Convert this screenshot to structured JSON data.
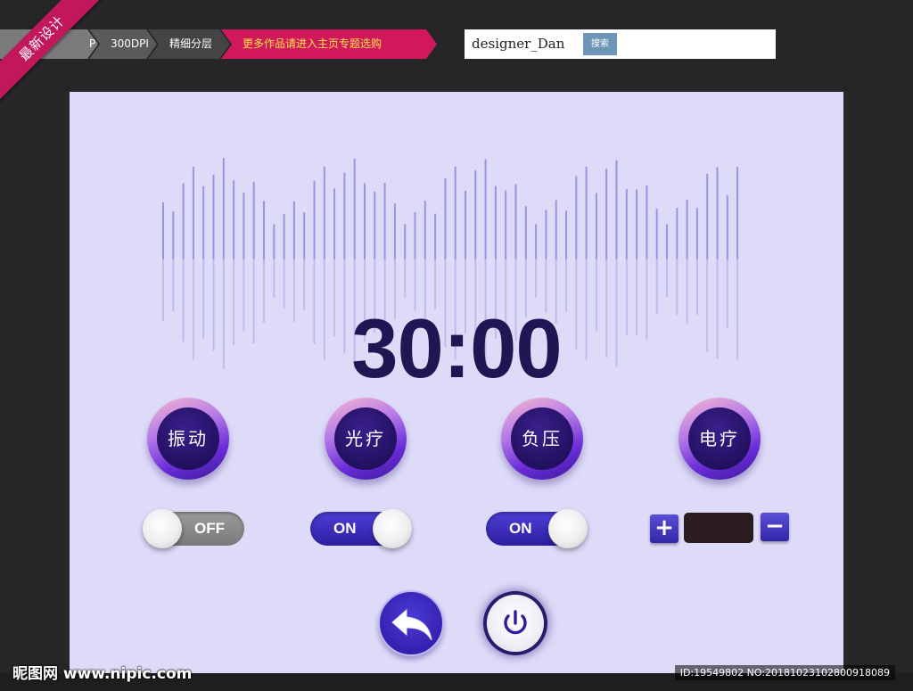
{
  "header": {
    "corner_ribbon": "最新设计",
    "crumbs": [
      "PSD",
      "300DPI",
      "精细分层",
      "更多作品请进入主页专题选购"
    ],
    "search": {
      "value": "designer_Dan",
      "button_label": "搜索"
    }
  },
  "timer": {
    "value": "30:00"
  },
  "modes": [
    {
      "label": "振动",
      "toggle": "OFF"
    },
    {
      "label": "光疗",
      "toggle": "ON"
    },
    {
      "label": "负压",
      "toggle": "ON"
    },
    {
      "label": "电疗",
      "stepper": {
        "plus": "+",
        "minus": "−",
        "value": ""
      }
    }
  ],
  "controls": {
    "back_icon": "undo-arrow-icon",
    "power_icon": "power-icon"
  },
  "watermark": {
    "left": "昵图网 www.nipic.com",
    "right": "ID:19549802 NO:20181023102800918089"
  },
  "colors": {
    "panel_bg": "#dedbf9",
    "timer_text": "#1f1654",
    "accent": "#3a2bc0",
    "ribbon": "#c2185b",
    "wave": "#9a94e0"
  }
}
